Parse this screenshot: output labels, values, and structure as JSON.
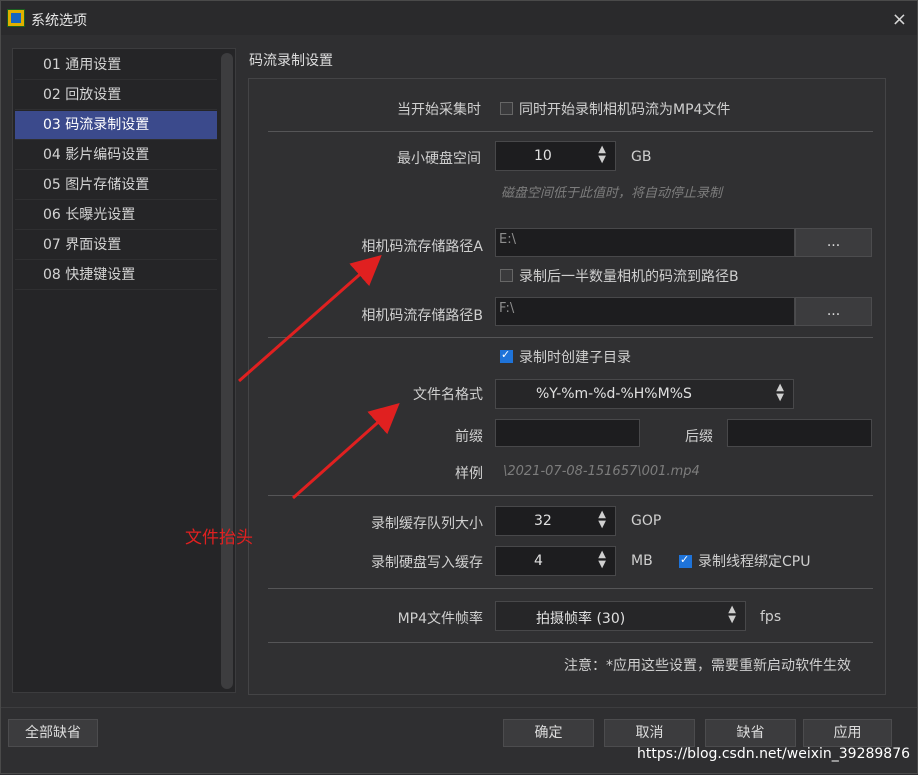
{
  "window": {
    "title": "系统选项",
    "close": "×"
  },
  "sidebar": {
    "items": [
      {
        "label": "01 通用设置"
      },
      {
        "label": "02 回放设置"
      },
      {
        "label": "03 码流录制设置"
      },
      {
        "label": "04 影片编码设置"
      },
      {
        "label": "05 图片存储设置"
      },
      {
        "label": "06 长曝光设置"
      },
      {
        "label": "07 界面设置"
      },
      {
        "label": "08 快捷键设置"
      }
    ],
    "active_index": 2
  },
  "main": {
    "section_title": "码流录制设置",
    "start_capture": {
      "label": "当开始采集时",
      "checkbox": "同时开始录制相机码流为MP4文件",
      "checked": false
    },
    "min_disk": {
      "label": "最小硬盘空间",
      "value": "10",
      "unit": "GB",
      "hint": "磁盘空间低于此值时，将自动停止录制"
    },
    "path_a": {
      "label": "相机码流存储路径A",
      "value": "E:\\",
      "browse": "..."
    },
    "half_to_b": {
      "checkbox": "录制后一半数量相机的码流到路径B",
      "checked": false
    },
    "path_b": {
      "label": "相机码流存储路径B",
      "value": "F:\\",
      "browse": "..."
    },
    "subdir": {
      "checkbox": "录制时创建子目录",
      "checked": true
    },
    "file_name": {
      "label": "文件名格式",
      "value": "%Y-%m-%d-%H%M%S"
    },
    "prefix": {
      "label": "前缀",
      "value": ""
    },
    "suffix": {
      "label": "后缀",
      "value": ""
    },
    "example": {
      "label": "样例",
      "value": "\\2021-07-08-151657\\001.mp4"
    },
    "queue": {
      "label": "录制缓存队列大小",
      "value": "32",
      "unit": "GOP"
    },
    "disk_cache": {
      "label": "录制硬盘写入缓存",
      "value": "4",
      "unit": "MB",
      "checkbox": "录制线程绑定CPU",
      "checked": true
    },
    "mp4_rate": {
      "label": "MP4文件帧率",
      "value": "拍摄帧率 (30)",
      "unit": "fps"
    },
    "note": "注意：*应用这些设置，需要重新启动软件生效"
  },
  "footer": {
    "defaults_all": "全部缺省",
    "ok": "确定",
    "cancel": "取消",
    "default": "缺省",
    "apply": "应用"
  },
  "annotation": {
    "text": "文件抬头",
    "color": "#e02020"
  },
  "watermark": "https://blog.csdn.net/weixin_39289876"
}
